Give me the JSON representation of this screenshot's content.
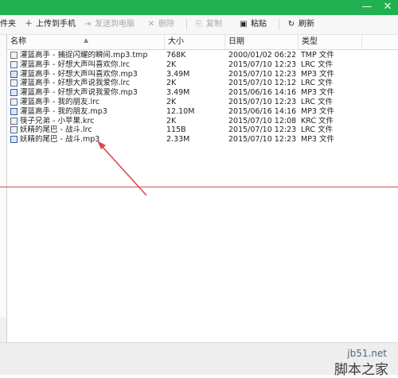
{
  "window": {
    "minimize_icon": "minimize-icon",
    "close_icon": "close-icon",
    "minimize_label": "—",
    "close_label": "✕"
  },
  "toolbar": {
    "prev_label": "件夹",
    "upload_label": "上传到手机",
    "send_label": "发送到电脑",
    "delete_label": "删除",
    "copy_label": "复制",
    "paste_label": "粘贴",
    "refresh_label": "刷新",
    "upload_icon": "＋",
    "send_icon": "⇥",
    "delete_icon": "✕",
    "copy_icon": "⎘",
    "paste_icon": "▣",
    "refresh_icon": "↻"
  },
  "columns": {
    "name": "名称",
    "size": "大小",
    "date": "日期",
    "type": "类型"
  },
  "files": [
    {
      "name": "灌篮高手 - 捕捉闪耀的瞬间.mp3.tmp",
      "size": "768K",
      "date": "2000/01/02 06:22",
      "type": "TMP 文件",
      "icon": "tmp"
    },
    {
      "name": "灌篮高手 - 好想大声叫喜欢你.lrc",
      "size": "2K",
      "date": "2015/07/10 12:23",
      "type": "LRC 文件",
      "icon": "lrc"
    },
    {
      "name": "灌篮高手 - 好想大声叫喜欢你.mp3",
      "size": "3.49M",
      "date": "2015/07/10 12:23",
      "type": "MP3 文件",
      "icon": "mp3"
    },
    {
      "name": "灌篮高手 - 好想大声说我爱你.lrc",
      "size": "2K",
      "date": "2015/07/10 12:12",
      "type": "LRC 文件",
      "icon": "lrc"
    },
    {
      "name": "灌篮高手 - 好想大声说我爱你.mp3",
      "size": "3.49M",
      "date": "2015/06/16 14:16",
      "type": "MP3 文件",
      "icon": "mp3"
    },
    {
      "name": "灌篮高手 - 我的朋友.lrc",
      "size": "2K",
      "date": "2015/07/10 12:23",
      "type": "LRC 文件",
      "icon": "lrc"
    },
    {
      "name": "灌篮高手 - 我的朋友.mp3",
      "size": "12.10M",
      "date": "2015/06/16 14:16",
      "type": "MP3 文件",
      "icon": "mp3"
    },
    {
      "name": "筷子兄弟 - 小苹果.krc",
      "size": "2K",
      "date": "2015/07/10 12:08",
      "type": "KRC 文件",
      "icon": "lrc"
    },
    {
      "name": "妖精的尾巴 - 战斗.lrc",
      "size": "115B",
      "date": "2015/07/10 12:23",
      "type": "LRC 文件",
      "icon": "lrc"
    },
    {
      "name": "妖精的尾巴 - 战斗.mp3",
      "size": "2.33M",
      "date": "2015/07/10 12:23",
      "type": "MP3 文件",
      "icon": "mp3"
    }
  ],
  "watermark": {
    "site": "jb51.net",
    "brand": "脚本之家"
  },
  "colors": {
    "titlebar": "#20b050",
    "annotation": "#d84a4a"
  }
}
